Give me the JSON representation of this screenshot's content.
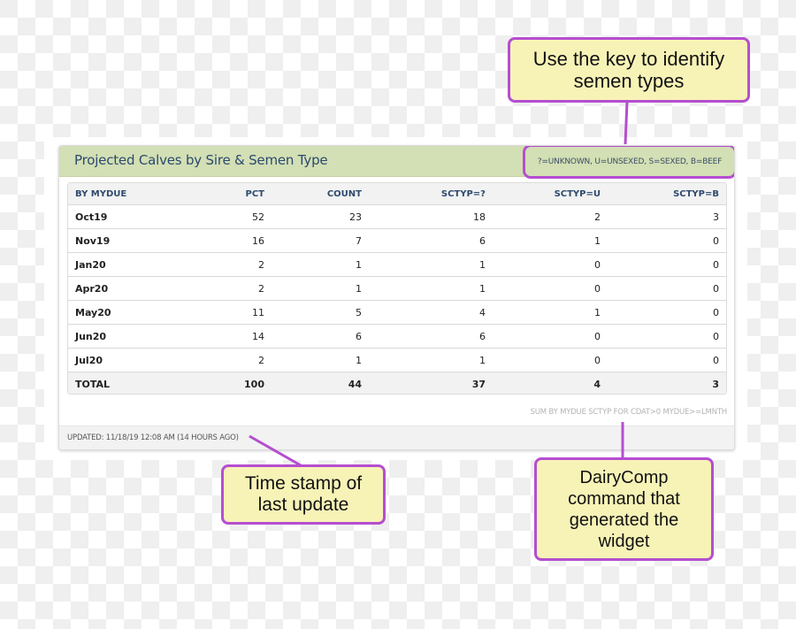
{
  "widget": {
    "title": "Projected Calves by Sire & Semen Type",
    "key": "?=UNKNOWN, U=UNSEXED, S=SEXED, B=BEEF",
    "columns": [
      "BY MYDUE",
      "PCT",
      "COUNT",
      "SCTYP=?",
      "SCTYP=U",
      "SCTYP=B"
    ],
    "rows": [
      [
        "Oct19",
        "52",
        "23",
        "18",
        "2",
        "3"
      ],
      [
        "Nov19",
        "16",
        "7",
        "6",
        "1",
        "0"
      ],
      [
        "Jan20",
        "2",
        "1",
        "1",
        "0",
        "0"
      ],
      [
        "Apr20",
        "2",
        "1",
        "1",
        "0",
        "0"
      ],
      [
        "May20",
        "11",
        "5",
        "4",
        "1",
        "0"
      ],
      [
        "Jun20",
        "14",
        "6",
        "6",
        "0",
        "0"
      ],
      [
        "Jul20",
        "2",
        "1",
        "1",
        "0",
        "0"
      ]
    ],
    "total": [
      "TOTAL",
      "100",
      "44",
      "37",
      "4",
      "3"
    ],
    "command": "SUM BY MYDUE SCTYP FOR CDAT>0 MYDUE>=LMNTH",
    "updated": "UPDATED: 11/18/19 12:08 AM (14 HOURS AGO)"
  },
  "callouts": {
    "key": [
      "Use the key to identify",
      "semen types"
    ],
    "timestamp": [
      "Time stamp of",
      "last update"
    ],
    "command": [
      "DairyComp",
      "command that",
      "generated the",
      "widget"
    ]
  },
  "colors": {
    "header_bg": "#d3dfb4",
    "title_text": "#2b4a6e",
    "callout_border": "#b54ed0",
    "callout_bg": "#f7f3b7"
  }
}
